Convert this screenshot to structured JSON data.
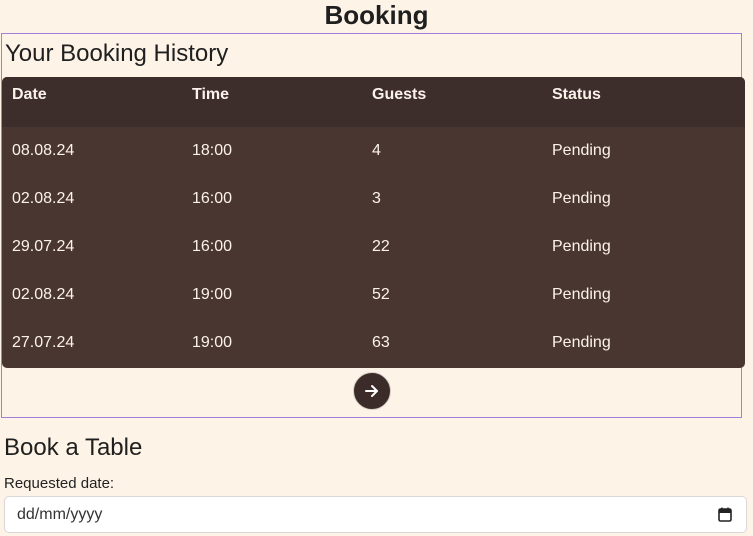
{
  "page": {
    "title": "Booking"
  },
  "history": {
    "title": "Your Booking History",
    "columns": [
      "Date",
      "Time",
      "Guests",
      "Status"
    ],
    "rows": [
      [
        "08.08.24",
        "18:00",
        "4",
        "Pending"
      ],
      [
        "02.08.24",
        "16:00",
        "3",
        "Pending"
      ],
      [
        "29.07.24",
        "16:00",
        "22",
        "Pending"
      ],
      [
        "02.08.24",
        "19:00",
        "52",
        "Pending"
      ],
      [
        "27.07.24",
        "19:00",
        "63",
        "Pending"
      ]
    ],
    "next_icon": "arrow-right-icon"
  },
  "booking_form": {
    "title": "Book a Table",
    "date_label": "Requested date:",
    "date_placeholder": "dd/mm/yyyy",
    "date_icon": "calendar-icon"
  },
  "colors": {
    "background": "#fdf3e7",
    "table_body": "#4a3630",
    "table_header": "#3d2d2b",
    "section_border": "#a57ed8"
  }
}
